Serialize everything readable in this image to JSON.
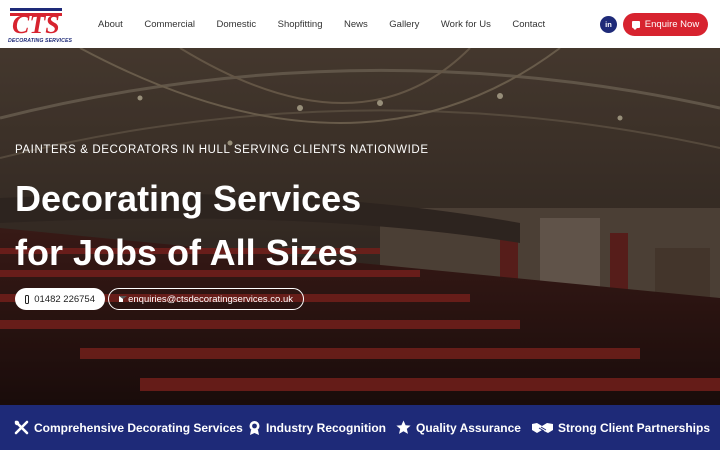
{
  "brand": {
    "logo_letters": "CTS",
    "logo_subtitle": "DECORATING SERVICES"
  },
  "nav": {
    "items": [
      {
        "label": "About"
      },
      {
        "label": "Commercial"
      },
      {
        "label": "Domestic"
      },
      {
        "label": "Shopfitting"
      },
      {
        "label": "News"
      },
      {
        "label": "Gallery"
      },
      {
        "label": "Work for Us"
      },
      {
        "label": "Contact"
      }
    ]
  },
  "header": {
    "linkedin_label": "in",
    "enquire_label": "Enquire Now",
    "enquire_icon": "chat-icon"
  },
  "hero": {
    "tagline": "PAINTERS & DECORATORS IN HULL SERVING CLIENTS NATIONWIDE",
    "headline_line1": "Decorating Services",
    "headline_line2": "for Jobs of All Sizes",
    "phone": "01482 226754",
    "phone_icon": "mobile-phone-icon",
    "email": "enquiries@ctsdecoratingservices.co.uk",
    "email_icon": "envelope-icon"
  },
  "features": [
    {
      "label": "Comprehensive Decorating Services",
      "icon": "tools-icon"
    },
    {
      "label": "Industry Recognition",
      "icon": "award-icon"
    },
    {
      "label": "Quality Assurance",
      "icon": "star-icon"
    },
    {
      "label": "Strong Client Partnerships",
      "icon": "handshake-icon"
    }
  ],
  "colors": {
    "brand_navy": "#1e2a78",
    "brand_red": "#d7232f",
    "text_dark": "#333333",
    "white": "#ffffff"
  }
}
